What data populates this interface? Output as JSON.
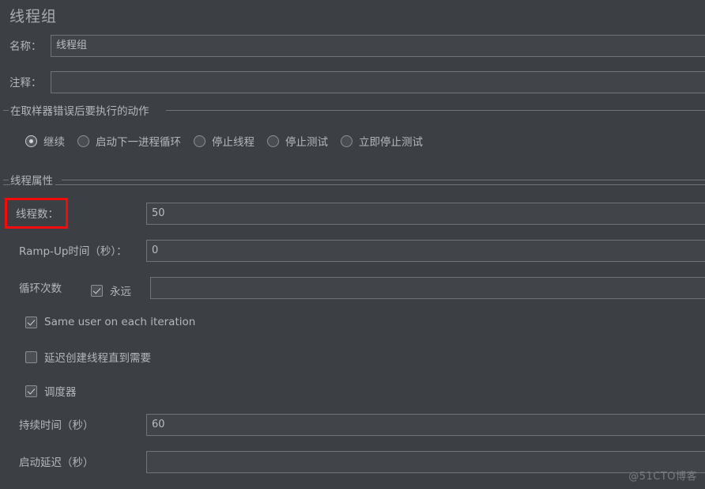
{
  "page": {
    "title": "线程组",
    "watermark": "@51CTO博客"
  },
  "name_field": {
    "label": "名称：",
    "value": "线程组",
    "placeholder": ""
  },
  "comment_field": {
    "label": "注释：",
    "value": "",
    "placeholder": ""
  },
  "error_action_group": {
    "title": "在取样器错误后要执行的动作",
    "options": [
      {
        "label": "继续",
        "selected": true
      },
      {
        "label": "启动下一进程循环",
        "selected": false
      },
      {
        "label": "停止线程",
        "selected": false
      },
      {
        "label": "停止测试",
        "selected": false
      },
      {
        "label": "立即停止测试",
        "selected": false
      }
    ]
  },
  "thread_properties_group": {
    "title": "线程属性",
    "thread_count": {
      "label": "线程数：",
      "value": "50",
      "highlighted": true
    },
    "ramp_up": {
      "label": "Ramp-Up时间（秒）：",
      "value": "0"
    },
    "loop_count": {
      "label": "循环次数",
      "forever_label": "永远",
      "forever_checked": true,
      "value": ""
    },
    "same_user": {
      "label": "Same user on each iteration",
      "checked": true
    },
    "delay_thread_creation": {
      "label": "延迟创建线程直到需要",
      "checked": false
    },
    "scheduler": {
      "label": "调度器",
      "checked": true
    },
    "duration": {
      "label": "持续时间（秒）",
      "value": "60"
    },
    "startup_delay": {
      "label": "启动延迟（秒）",
      "value": ""
    }
  },
  "colors": {
    "panel_bg": "#3c4044",
    "input_bg": "#41454a",
    "border": "#6e7478",
    "text": "#b3b7bb",
    "highlight": "#f40b0b"
  }
}
